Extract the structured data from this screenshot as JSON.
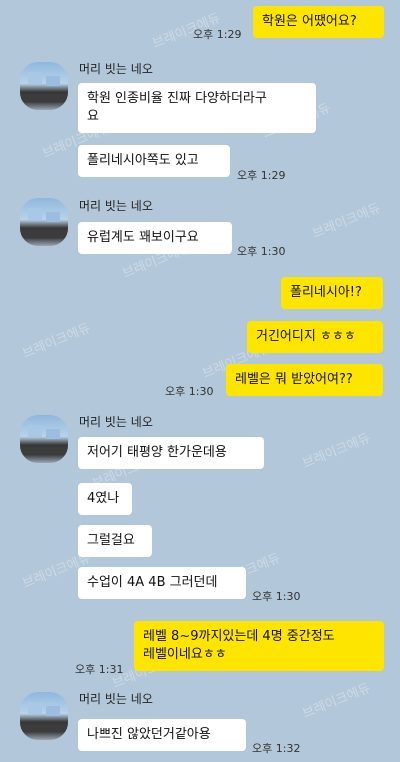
{
  "watermark": "브레이크에듀",
  "contact": {
    "name": "머리 빗는 네오"
  },
  "messages": {
    "m1": {
      "text": "학원은 어땠어요?",
      "time": "오후 1:29"
    },
    "m2": {
      "text": "학원 인종비율 진짜 다양하더라구\n요"
    },
    "m3": {
      "text": "폴리네시아쪽도 있고",
      "time": "오후 1:29"
    },
    "m4": {
      "text": "유럽계도 꽤보이구요",
      "time": "오후 1:30"
    },
    "m5": {
      "text": "폴리네시아!?"
    },
    "m6": {
      "text": "거긴어디지 ㅎㅎㅎ"
    },
    "m7": {
      "text": "레벨은 뭐 받았어여??",
      "time": "오후 1:30"
    },
    "m8": {
      "text": "저어기 태평양 한가운데용"
    },
    "m9": {
      "text": "4였나"
    },
    "m10": {
      "text": "그럴걸요"
    },
    "m11": {
      "text": "수업이 4A 4B 그러던데",
      "time": "오후 1:30"
    },
    "m12": {
      "text": "레벨 8~9까지있는데 4명 중간정도\n레벨이네요ㅎㅎ",
      "time": "오후 1:31"
    },
    "m13": {
      "text": "나쁘진 않았던거같아용",
      "time": "오후 1:32"
    }
  }
}
